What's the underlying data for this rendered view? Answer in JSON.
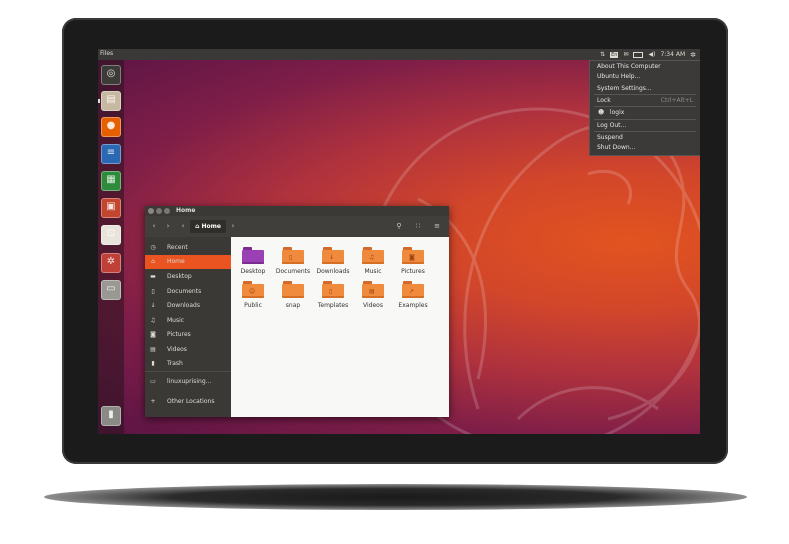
{
  "top_bar": {
    "app_name": "Files",
    "clock": "7:34 AM",
    "tray_icons": [
      "network-icon",
      "keyboard-en-icon",
      "mail-icon",
      "battery-icon",
      "volume-icon",
      "gear-icon"
    ],
    "keyboard_label": "En"
  },
  "system_menu": {
    "items": [
      {
        "label": "About This Computer"
      },
      {
        "label": "Ubuntu Help..."
      },
      {
        "label": "System Settings..."
      },
      {
        "label": "Lock",
        "shortcut": "Ctrl+Alt+L"
      },
      {
        "label": "logix",
        "icon": "user-icon"
      },
      {
        "label": "Log Out..."
      },
      {
        "label": "Suspend"
      },
      {
        "label": "Shut Down..."
      }
    ]
  },
  "launcher": {
    "items": [
      {
        "name": "ubuntu-dash",
        "icon": "ubuntu-logo-icon",
        "color": "#3c3b37"
      },
      {
        "name": "files",
        "icon": "file-cabinet-icon",
        "color": "#c7b9a1"
      },
      {
        "name": "firefox",
        "icon": "firefox-icon",
        "color": "#e66000"
      },
      {
        "name": "writer",
        "icon": "writer-icon",
        "color": "#2b68b3"
      },
      {
        "name": "calc",
        "icon": "calc-icon",
        "color": "#2e8b3b"
      },
      {
        "name": "impress",
        "icon": "impress-icon",
        "color": "#c2452d"
      },
      {
        "name": "software",
        "icon": "shopping-bag-icon",
        "color": "#e8e3db"
      },
      {
        "name": "settings",
        "icon": "gear-wrench-icon",
        "color": "#bf4036"
      },
      {
        "name": "drive",
        "icon": "drive-icon",
        "color": "#9a9893"
      },
      {
        "name": "trash",
        "icon": "trash-icon",
        "color": "#8b8985"
      }
    ]
  },
  "window": {
    "title": "Home",
    "breadcrumb": "Home",
    "sidebar": [
      {
        "label": "Recent",
        "icon": "clock-icon"
      },
      {
        "label": "Home",
        "icon": "home-icon",
        "active": true
      },
      {
        "label": "Desktop",
        "icon": "folder-icon"
      },
      {
        "label": "Documents",
        "icon": "document-icon"
      },
      {
        "label": "Downloads",
        "icon": "download-icon"
      },
      {
        "label": "Music",
        "icon": "music-icon"
      },
      {
        "label": "Pictures",
        "icon": "camera-icon"
      },
      {
        "label": "Videos",
        "icon": "film-icon"
      },
      {
        "label": "Trash",
        "icon": "trash-icon"
      },
      {
        "label": "linuxuprising...",
        "icon": "drive-icon"
      },
      {
        "label": "Other Locations",
        "icon": "plus-icon"
      }
    ],
    "files": [
      {
        "label": "Desktop",
        "variant": "desktop"
      },
      {
        "label": "Documents",
        "variant": "documents"
      },
      {
        "label": "Downloads",
        "variant": "downloads"
      },
      {
        "label": "Music",
        "variant": "music"
      },
      {
        "label": "Pictures",
        "variant": "pictures"
      },
      {
        "label": "Public",
        "variant": "public"
      },
      {
        "label": "snap",
        "variant": "plain"
      },
      {
        "label": "Templates",
        "variant": "templates"
      },
      {
        "label": "Videos",
        "variant": "videos"
      },
      {
        "label": "Examples",
        "variant": "examples"
      }
    ]
  },
  "colors": {
    "accent": "#e95420",
    "panel": "#3a3936",
    "folder": "#f08a3c"
  }
}
